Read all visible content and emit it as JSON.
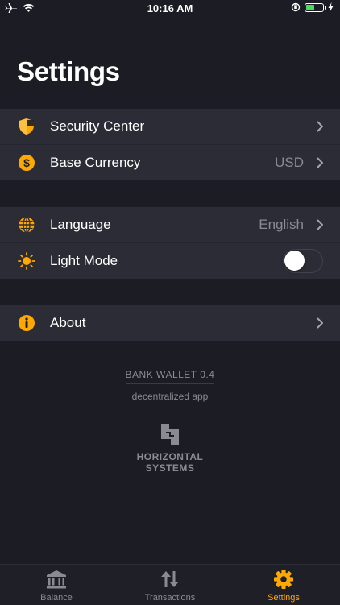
{
  "status_bar": {
    "time": "10:16 AM",
    "battery_level": 0.5
  },
  "page": {
    "title": "Settings"
  },
  "settings": {
    "group1": [
      {
        "label": "Security Center",
        "icon": "shield-icon"
      },
      {
        "label": "Base Currency",
        "value": "USD",
        "icon": "dollar-icon"
      }
    ],
    "group2": [
      {
        "label": "Language",
        "value": "English",
        "icon": "globe-icon"
      },
      {
        "label": "Light Mode",
        "icon": "sun-icon",
        "toggle_on": false
      }
    ],
    "group3": [
      {
        "label": "About",
        "icon": "info-icon"
      }
    ]
  },
  "footer": {
    "app_version": "BANK WALLET 0.4",
    "app_description": "decentralized app",
    "company_line1": "HORIZONTAL",
    "company_line2": "SYSTEMS"
  },
  "tabbar": {
    "tabs": [
      {
        "label": "Balance",
        "icon": "bank-icon",
        "active": false
      },
      {
        "label": "Transactions",
        "icon": "transfer-arrows-icon",
        "active": false
      },
      {
        "label": "Settings",
        "icon": "gear-icon",
        "active": true
      }
    ]
  },
  "colors": {
    "accent": "#ffa800",
    "background": "#1c1d24",
    "row_background": "#2b2c35",
    "secondary_text": "#8a8b92"
  }
}
